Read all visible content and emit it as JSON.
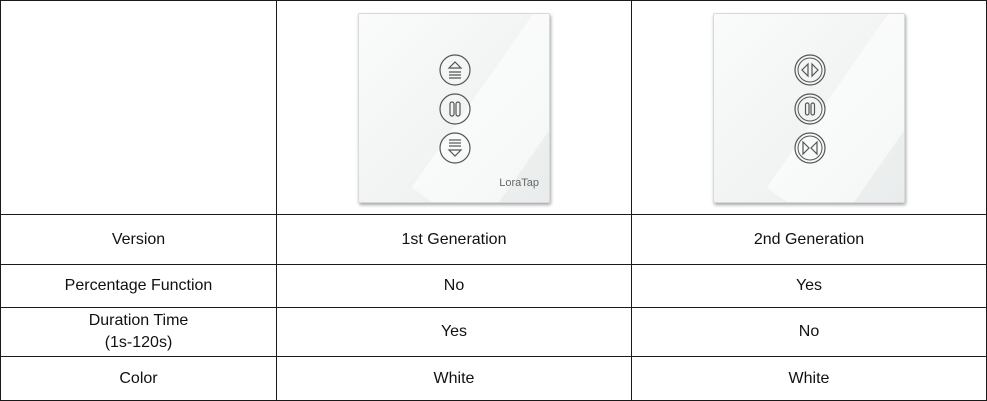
{
  "rows": [
    {
      "label": "Version",
      "gen1": "1st Generation",
      "gen2": "2nd Generation"
    },
    {
      "label": "Percentage Function",
      "gen1": "No",
      "gen2": "Yes"
    },
    {
      "label_line1": "Duration Time",
      "label_line2": "(1s-120s)",
      "gen1": "Yes",
      "gen2": "No"
    },
    {
      "label": "Color",
      "gen1": "White",
      "gen2": "White"
    }
  ],
  "panels": {
    "gen1": {
      "brand": "LoraTap",
      "icons": [
        "curtain-up-icon",
        "pause-icon",
        "curtain-down-icon"
      ]
    },
    "gen2": {
      "icons": [
        "curtain-open-icon",
        "pause-icon",
        "curtain-close-icon"
      ]
    }
  },
  "colors": {
    "panel": "#f1f3f3",
    "icon_stroke": "#555555",
    "border": "#1a1a1a"
  }
}
